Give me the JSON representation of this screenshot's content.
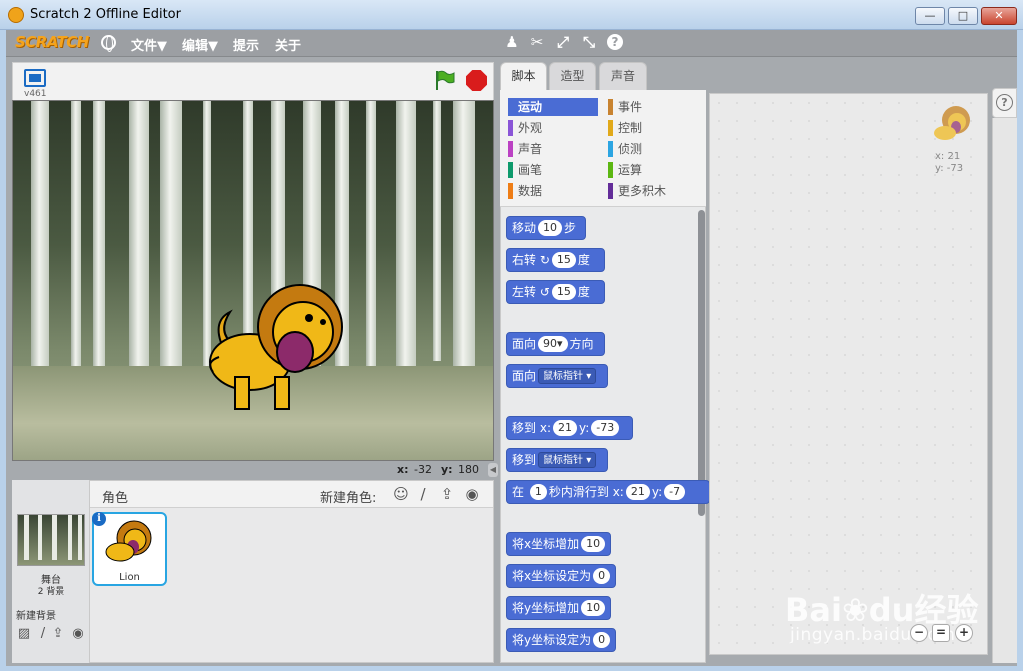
{
  "window": {
    "title": "Scratch 2 Offline Editor",
    "min": "—",
    "max": "□",
    "close": "✕"
  },
  "menubar": {
    "logo": "SCRATCH",
    "items": [
      "文件▼",
      "编辑▼",
      "提示",
      "关于"
    ],
    "tools": {
      "stamp": "♟",
      "cut": "✂",
      "grow": "⤢",
      "shrink": "⤡",
      "help": "?"
    }
  },
  "stage": {
    "version": "v461",
    "mouse_x_label": "x:",
    "mouse_x": "-32",
    "mouse_y_label": "y:",
    "mouse_y": "180"
  },
  "sprites": {
    "header": "角色",
    "new_sprite_label": "新建角色:",
    "stage_label": "舞台",
    "stage_bg_count": "2 背景",
    "new_backdrop_label": "新建背景",
    "items": [
      {
        "name": "Lion"
      }
    ]
  },
  "tabs": [
    "脚本",
    "造型",
    "声音"
  ],
  "categories": [
    {
      "label": "运动",
      "color": "#4a6cd4",
      "selected": true
    },
    {
      "label": "事件",
      "color": "#c88330"
    },
    {
      "label": "外观",
      "color": "#8a55d7"
    },
    {
      "label": "控制",
      "color": "#e1a91a"
    },
    {
      "label": "声音",
      "color": "#bb42c3"
    },
    {
      "label": "侦测",
      "color": "#2ca5e2"
    },
    {
      "label": "画笔",
      "color": "#0e9a6c"
    },
    {
      "label": "运算",
      "color": "#5cb712"
    },
    {
      "label": "数据",
      "color": "#ee7d16"
    },
    {
      "label": "更多积木",
      "color": "#632d99"
    }
  ],
  "blocks": {
    "move": {
      "pre": "移动",
      "val": "10",
      "post": "步"
    },
    "turn_right": {
      "pre": "右转",
      "icon": "↻",
      "val": "15",
      "post": "度"
    },
    "turn_left": {
      "pre": "左转",
      "icon": "↺",
      "val": "15",
      "post": "度"
    },
    "point_dir": {
      "pre": "面向",
      "val": "90▾",
      "post": "方向"
    },
    "point_towards": {
      "pre": "面向",
      "drop": "鼠标指针 ▾"
    },
    "goto_xy": {
      "pre": "移到",
      "xl": "x:",
      "x": "21",
      "yl": "y:",
      "y": "-73"
    },
    "goto": {
      "pre": "移到",
      "drop": "鼠标指针 ▾"
    },
    "glide": {
      "pre": "在",
      "secs": "1",
      "mid": "秒内滑行到",
      "xl": "x:",
      "x": "21",
      "yl": "y:",
      "y": "-7"
    },
    "change_x": {
      "pre": "将x坐标增加",
      "val": "10"
    },
    "set_x": {
      "pre": "将x坐标设定为",
      "val": "0"
    },
    "change_y": {
      "pre": "将y坐标增加",
      "val": "10"
    },
    "set_y": {
      "pre": "将y坐标设定为",
      "val": "0"
    }
  },
  "script_area": {
    "x_label": "x: 21",
    "y_label": "y: -73"
  },
  "watermark": {
    "brand": "Bai❀du经验",
    "url": "jingyan.baidu.com"
  },
  "icons": {
    "zoom_out": "−",
    "zoom_reset": "=",
    "zoom_in": "+",
    "info": "i",
    "help": "?",
    "ns_library": "☺",
    "ns_paint": "/",
    "ns_upload": "⇪",
    "ns_camera": "◉",
    "collapse": "◀"
  }
}
